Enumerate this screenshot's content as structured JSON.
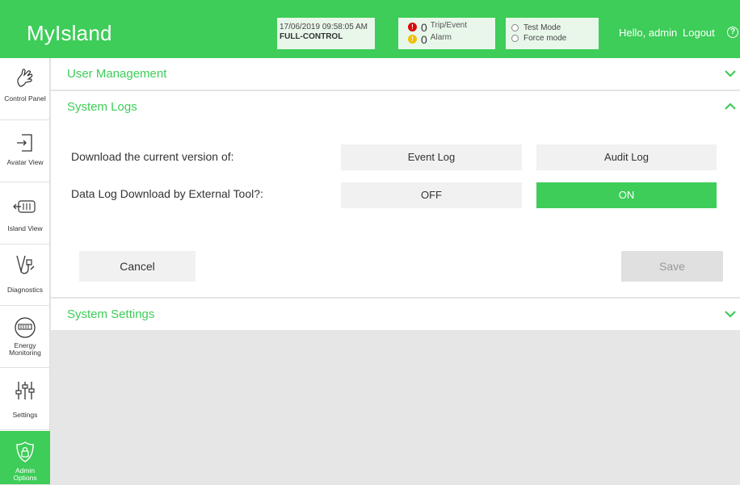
{
  "header": {
    "brand": "MyIsland",
    "datetime": "17/06/2019 09:58:05 AM",
    "control_mode": "FULL-CONTROL",
    "trip_count": "0",
    "trip_label": "Trip/Event",
    "alarm_count": "0",
    "alarm_label": "Alarm",
    "test_mode_label": "Test Mode",
    "force_mode_label": "Force mode",
    "greeting": "Hello, admin",
    "logout_label": "Logout",
    "help_glyph": "?"
  },
  "sidebar": {
    "items": [
      {
        "label": "Control Panel",
        "icon": "hand-pointer-icon"
      },
      {
        "label": "Avatar View",
        "icon": "enter-door-icon"
      },
      {
        "label": "Island View",
        "icon": "island-modules-icon"
      },
      {
        "label": "Diagnostics",
        "icon": "stethoscope-icon"
      },
      {
        "label_line1": "Energy",
        "label_line2": "Monitoring",
        "icon": "meter-icon"
      },
      {
        "label": "Settings",
        "icon": "sliders-icon"
      },
      {
        "label_line1": "Admin",
        "label_line2": "Options",
        "icon": "shield-lock-icon",
        "active": true
      }
    ]
  },
  "sections": {
    "user_management": {
      "title": "User Management",
      "expanded": false
    },
    "system_logs": {
      "title": "System Logs",
      "expanded": true,
      "download_label": "Download the current version of:",
      "event_log_button": "Event Log",
      "audit_log_button": "Audit Log",
      "external_tool_label": "Data Log Download by External Tool?:",
      "off_button": "OFF",
      "on_button": "ON",
      "selected": "ON",
      "cancel_button": "Cancel",
      "save_button": "Save"
    },
    "system_settings": {
      "title": "System Settings",
      "expanded": false
    }
  },
  "colors": {
    "accent": "#3dcd58",
    "alarm_red": "#dc0a0a",
    "alarm_yellow": "#f0c000"
  }
}
